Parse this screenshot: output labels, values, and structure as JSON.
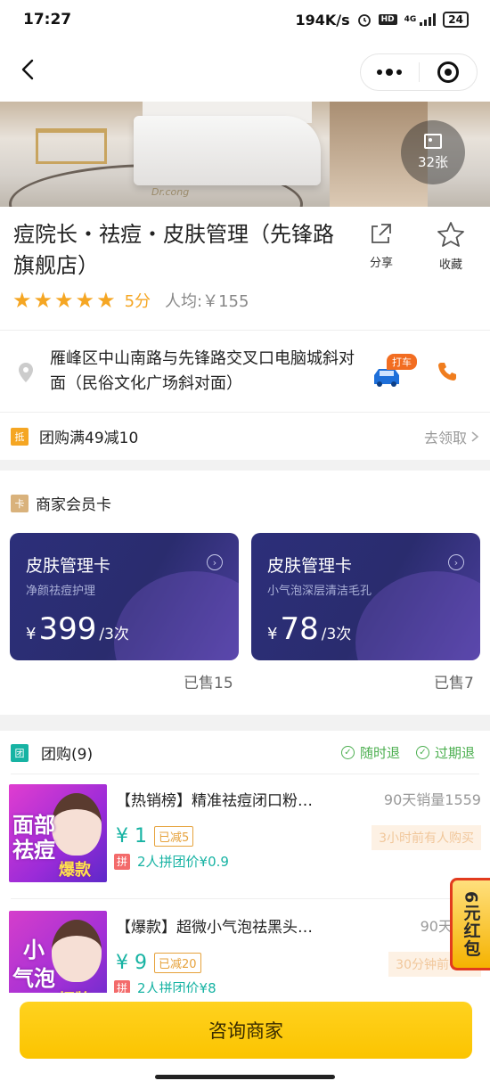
{
  "status_bar": {
    "time": "17:27",
    "network_speed": "194K/s",
    "hd": "HD",
    "network": "4G",
    "battery": "24"
  },
  "hero": {
    "photo_count": "32张",
    "logo_text": "Dr.cong"
  },
  "shop": {
    "name": "痘院长・祛痘・皮肤管理（先锋路旗舰店）",
    "share_label": "分享",
    "favorite_label": "收藏",
    "stars": 5,
    "score": "5分",
    "avg_price": "人均:￥155"
  },
  "address": {
    "text": "雁峰区中山南路与先锋路交叉口电脑城斜对面（民俗文化广场斜对面）",
    "taxi_label": "打车"
  },
  "coupon": {
    "badge": "抵",
    "text": "团购满49减10",
    "action": "去领取"
  },
  "member": {
    "badge": "卡",
    "title": "商家会员卡",
    "cards": [
      {
        "title": "皮肤管理卡",
        "subtitle": "净颜祛痘护理",
        "currency": "¥",
        "price": "399",
        "unit": "/3次",
        "sold": "已售15"
      },
      {
        "title": "皮肤管理卡",
        "subtitle": "小气泡深层清洁毛孔",
        "currency": "¥",
        "price": "78",
        "unit": "/3次",
        "sold": "已售7"
      }
    ]
  },
  "group": {
    "badge": "团",
    "title": "团购(9)",
    "refund_any": "随时退",
    "refund_expired": "过期退",
    "deals": [
      {
        "thumb_text1": "面部",
        "thumb_text2": "祛痘",
        "thumb_text3": "爆款",
        "title": "【热销榜】精准祛痘闭口粉…",
        "sales": "90天销量1559",
        "price": "¥ 1",
        "cut": "已减5",
        "recent": "3小时前有人购买",
        "pin_tag": "拼",
        "pin_text": "2人拼团价¥0.9"
      },
      {
        "thumb_text1": "小",
        "thumb_text2": "气泡",
        "thumb_text3": "招牌",
        "title": "【爆款】超微小气泡祛黑头…",
        "sales": "90天销量",
        "price": "¥ 9",
        "cut": "已减20",
        "recent": "30分钟前有人",
        "pin_tag": "拼",
        "pin_text": "2人拼团价¥8"
      }
    ]
  },
  "red_packet": "6元红包",
  "bottom": {
    "consult_label": "咨询商家"
  },
  "colors": {
    "accent_yellow": "#fbc400",
    "star": "#f5a623",
    "teal": "#17b3a3",
    "green": "#4caf50",
    "card_blue": "#2c2f7a"
  }
}
